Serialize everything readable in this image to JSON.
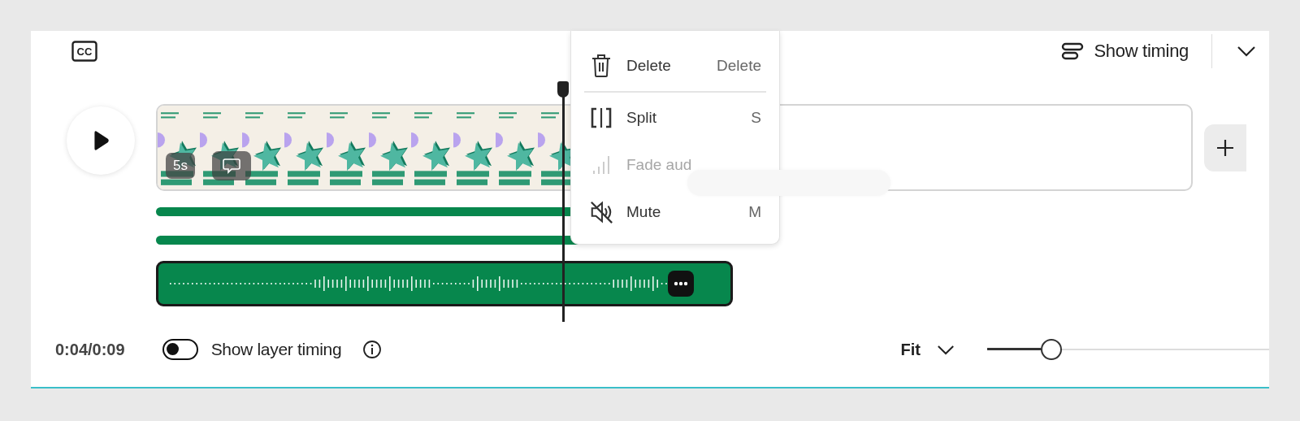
{
  "captions_button": {
    "label": "CC"
  },
  "show_timing": {
    "label": "Show timing"
  },
  "video_clip": {
    "duration": "5s"
  },
  "layer_bars": [
    {
      "kind": "bar"
    },
    {
      "kind": "bar"
    }
  ],
  "audio_clip": {
    "kind": "waveform"
  },
  "context_menu": {
    "items": [
      {
        "label": "Delete",
        "shortcut": "Delete",
        "disabled": false
      },
      {
        "label": "Split",
        "shortcut": "S",
        "disabled": false
      },
      {
        "label": "Fade aud",
        "disabled": true
      },
      {
        "label": "Mute",
        "shortcut": "M",
        "disabled": false
      }
    ]
  },
  "footer": {
    "time": "0:04/0:09",
    "layer_timing_toggle": {
      "label": "Show layer timing",
      "on": false
    },
    "zoom": {
      "label": "Fit",
      "level": 0.19
    }
  }
}
